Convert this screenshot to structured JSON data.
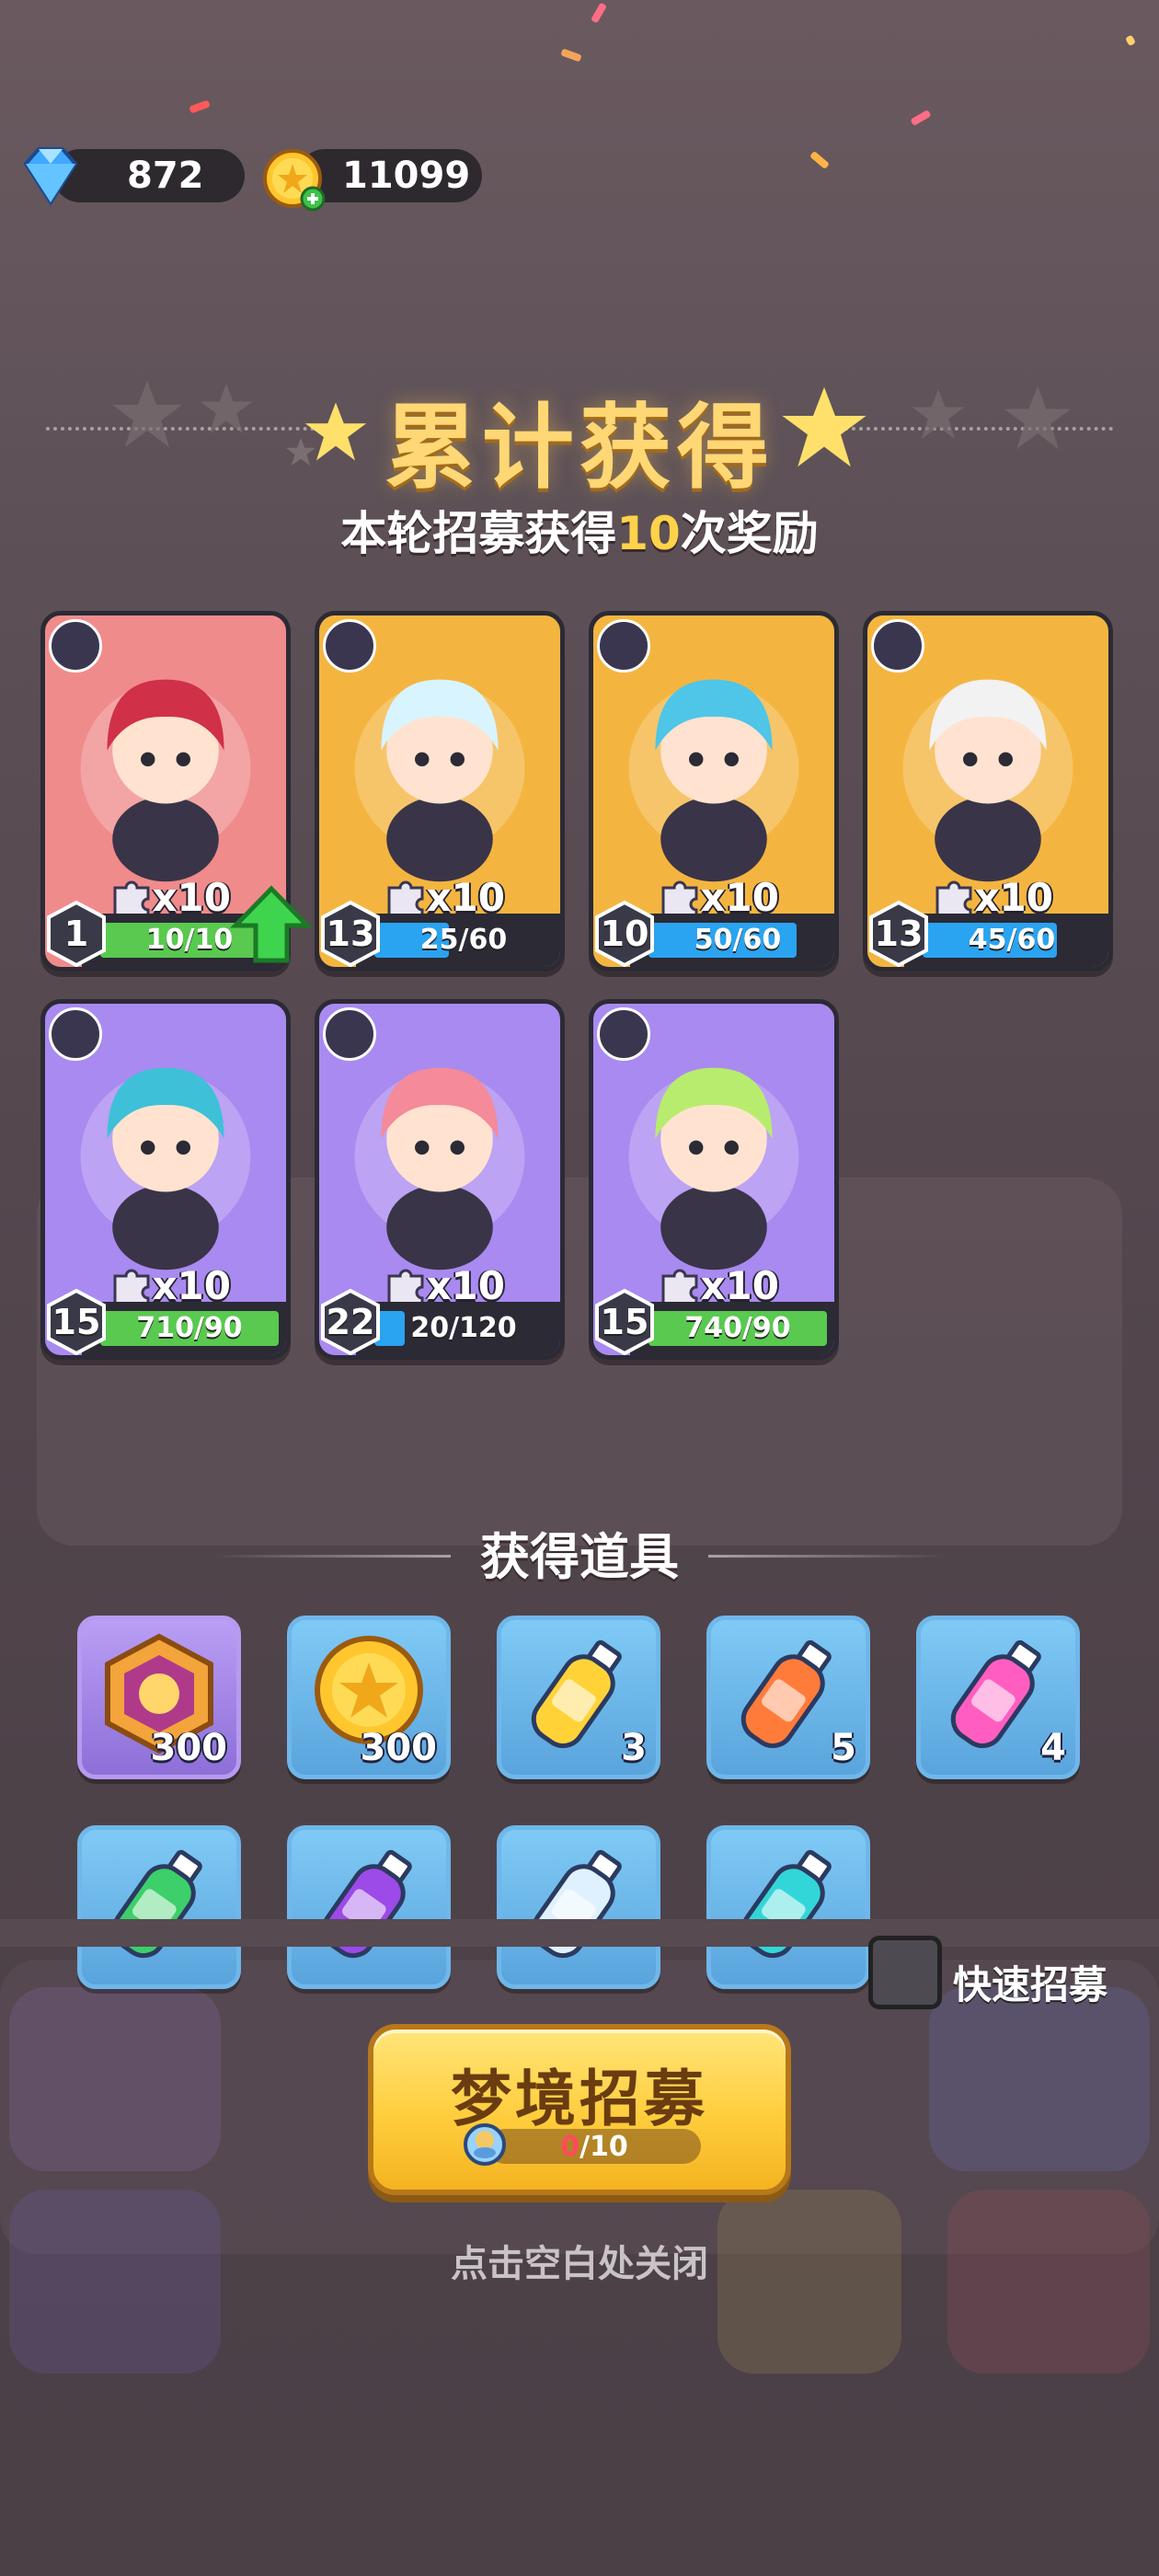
{
  "currency": {
    "gems": "872",
    "coins": "11099"
  },
  "header": {
    "title": "累计获得",
    "subtitle_prefix": "本轮招募获得",
    "subtitle_count": "10",
    "subtitle_suffix": "次奖励"
  },
  "cards": [
    {
      "count": "x10",
      "level": "1",
      "progress": "10/10",
      "fill": 1.0,
      "bar_color": "#59c94f",
      "bg": "#f08b8b",
      "upgrade": true
    },
    {
      "count": "x10",
      "level": "13",
      "progress": "25/60",
      "fill": 0.42,
      "bar_color": "#2aa3f0",
      "bg": "#f4b540",
      "upgrade": false
    },
    {
      "count": "x10",
      "level": "10",
      "progress": "50/60",
      "fill": 0.83,
      "bar_color": "#2aa3f0",
      "bg": "#f4b540",
      "upgrade": false
    },
    {
      "count": "x10",
      "level": "13",
      "progress": "45/60",
      "fill": 0.75,
      "bar_color": "#2aa3f0",
      "bg": "#f4b540",
      "upgrade": false
    },
    {
      "count": "x10",
      "level": "15",
      "progress": "710/90",
      "fill": 1.0,
      "bar_color": "#59c94f",
      "bg": "#a98af0",
      "upgrade": false
    },
    {
      "count": "x10",
      "level": "22",
      "progress": "20/120",
      "fill": 0.17,
      "bar_color": "#2aa3f0",
      "bg": "#a98af0",
      "upgrade": false
    },
    {
      "count": "x10",
      "level": "15",
      "progress": "740/90",
      "fill": 1.0,
      "bar_color": "#59c94f",
      "bg": "#a98af0",
      "upgrade": false
    }
  ],
  "items_section": {
    "title": "获得道具",
    "items": [
      {
        "icon": "hero-badge-icon",
        "qty": "300",
        "style": "purple"
      },
      {
        "icon": "gold-coin-icon",
        "qty": "300",
        "style": "blue"
      },
      {
        "icon": "yellow-bottle-icon",
        "qty": "3",
        "style": "blue"
      },
      {
        "icon": "orange-bottle-icon",
        "qty": "5",
        "style": "blue"
      },
      {
        "icon": "pink-bottle-icon",
        "qty": "4",
        "style": "blue"
      },
      {
        "icon": "green-bottle-icon",
        "qty": "",
        "style": "blue"
      },
      {
        "icon": "purple-bottle-icon",
        "qty": "",
        "style": "blue"
      },
      {
        "icon": "white-bottle-icon",
        "qty": "",
        "style": "blue"
      },
      {
        "icon": "cyan-bottle-icon",
        "qty": "",
        "style": "blue"
      }
    ]
  },
  "quick_recruit": {
    "label": "快速招募",
    "checked": false
  },
  "recruit_button": {
    "label": "梦境招募",
    "current": "0",
    "total": "/10"
  },
  "close_hint": "点击空白处关闭"
}
